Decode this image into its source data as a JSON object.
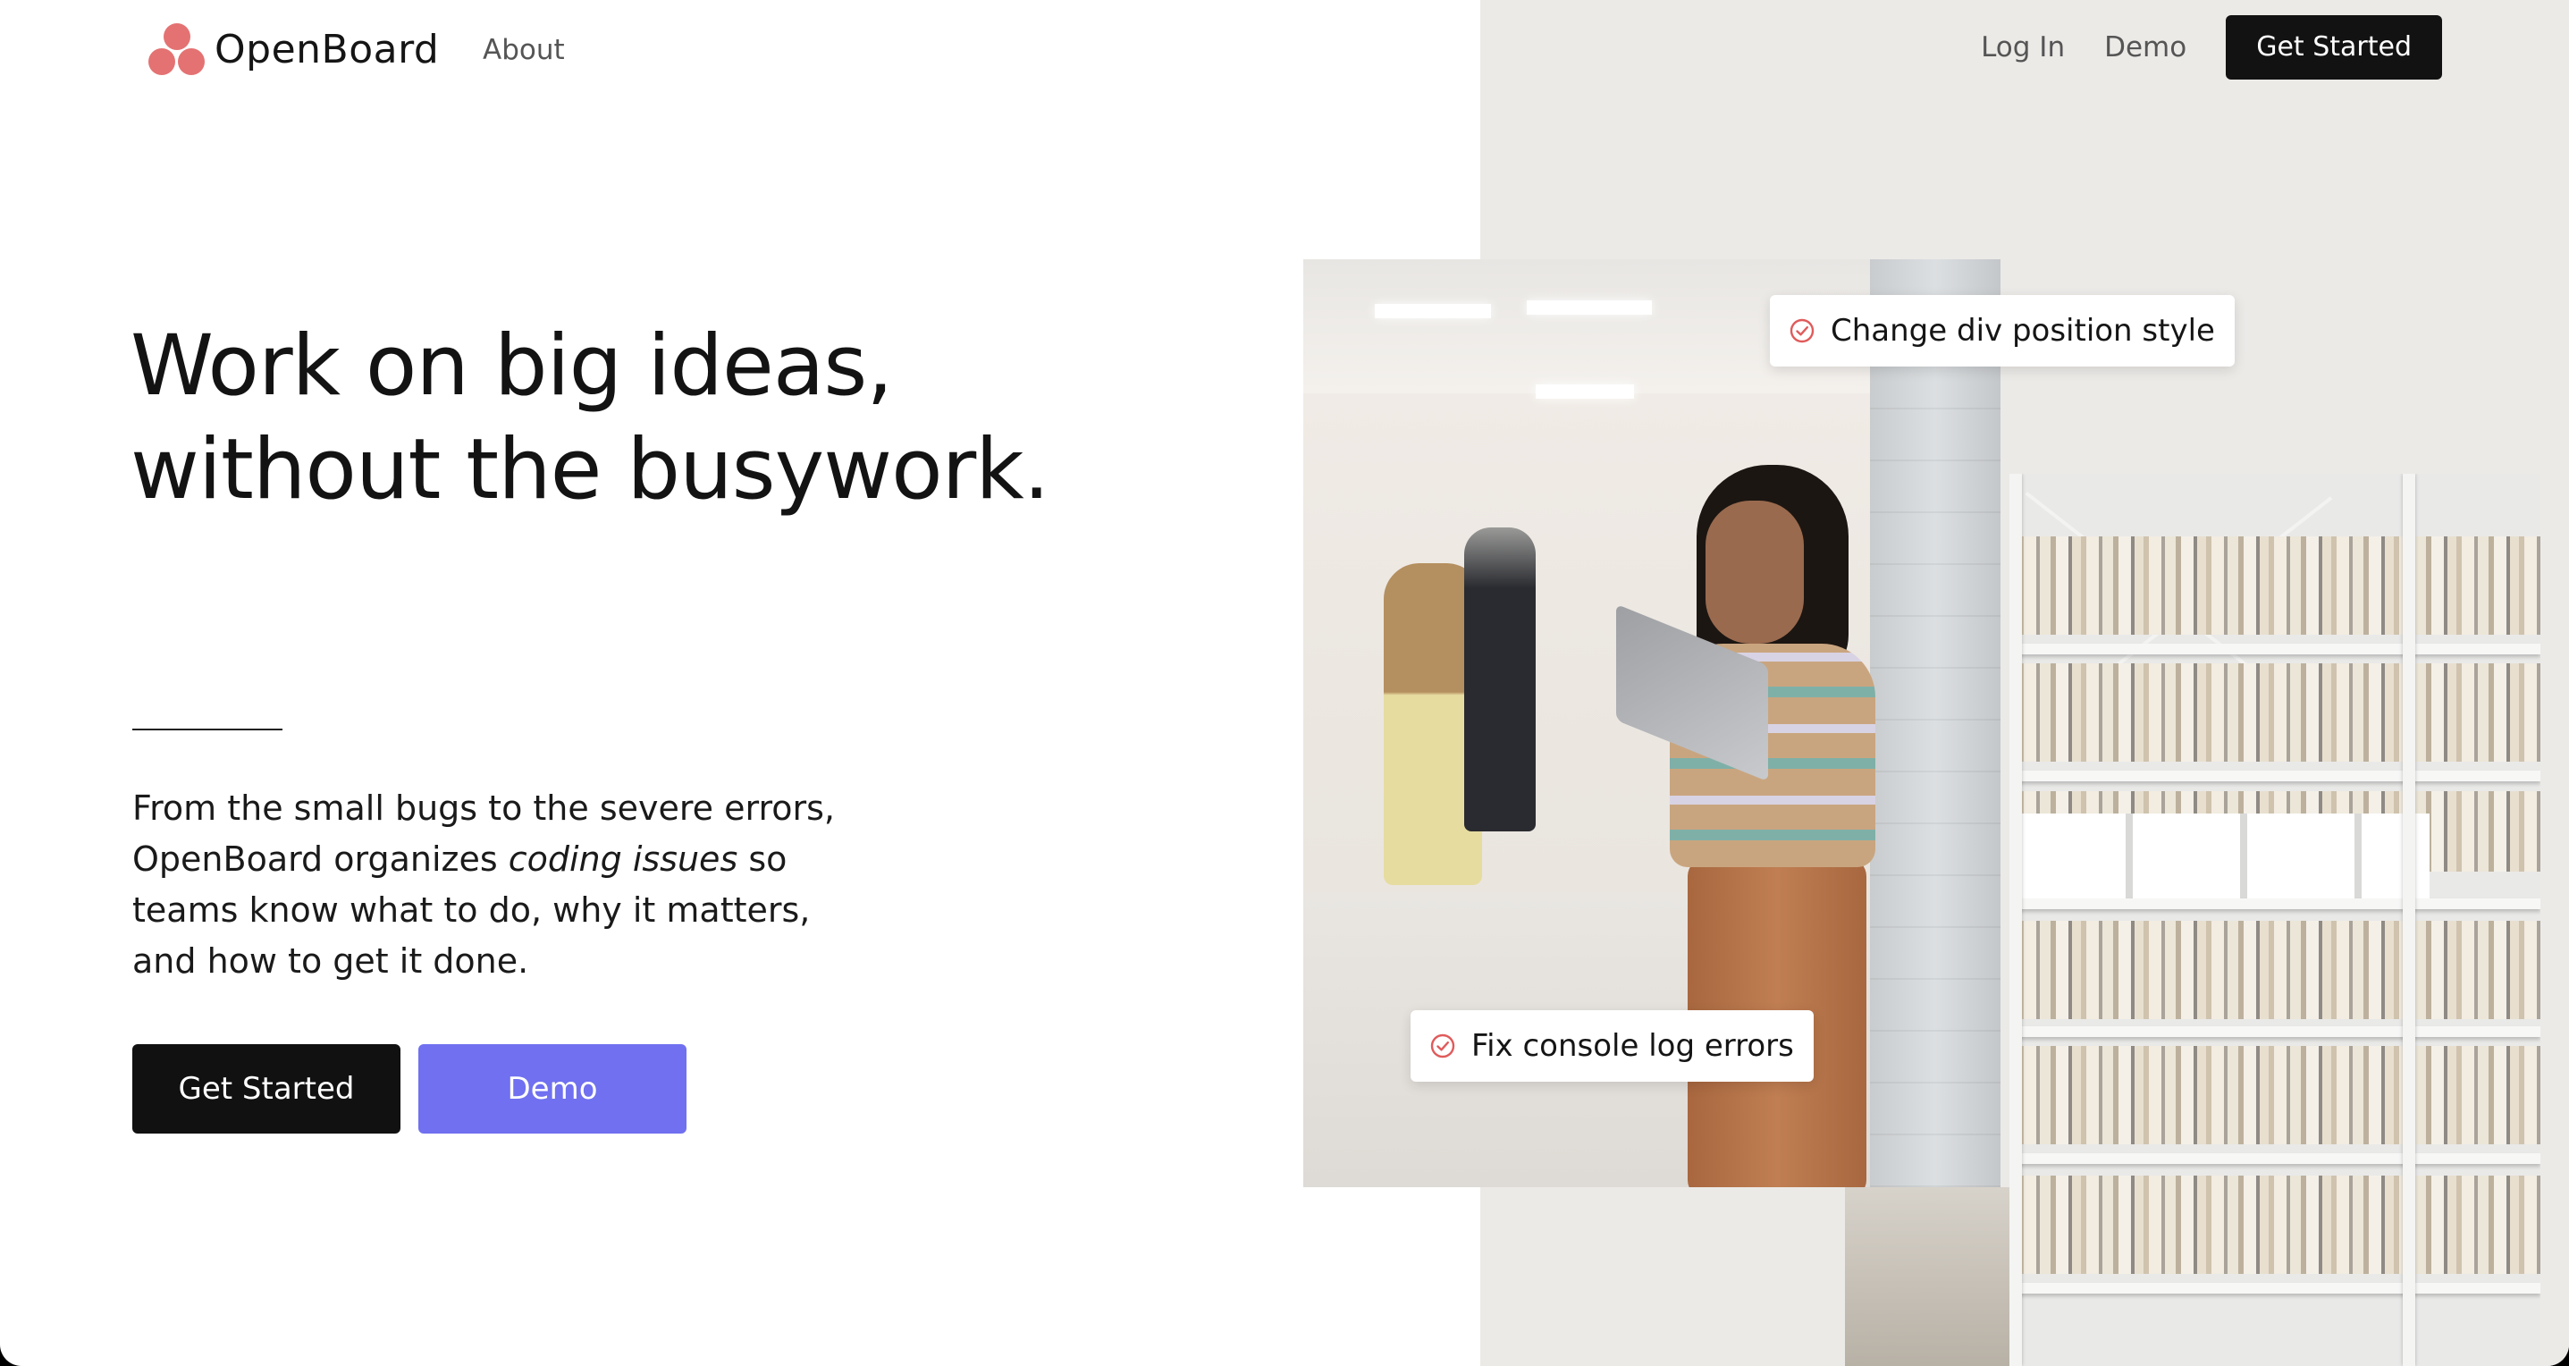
{
  "brand": {
    "name": "OpenBoard",
    "accent_color": "#e47272"
  },
  "nav": {
    "about": "About",
    "login": "Log In",
    "demo": "Demo",
    "cta": "Get Started"
  },
  "hero": {
    "headline_line1": "Work on big ideas,",
    "headline_line2": "without the busywork.",
    "body_part1": "From the small bugs to the severe errors, OpenBoard organizes ",
    "body_emphasis": "coding issues",
    "body_part2": " so teams know what to do, why it matters, and how to get it done.",
    "primary_button": "Get Started",
    "secondary_button": "Demo",
    "primary_color": "#111111",
    "secondary_color": "#7070f0"
  },
  "tasks": [
    {
      "label": "Change div position style",
      "icon": "check-circle-icon"
    },
    {
      "label": "Fix console log errors",
      "icon": "check-circle-icon"
    }
  ]
}
